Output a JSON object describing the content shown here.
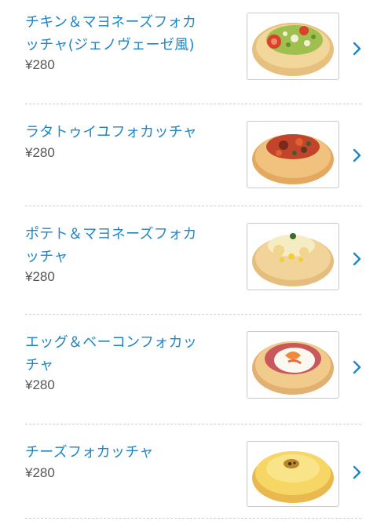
{
  "items": [
    {
      "name_line1": "チキン＆マヨネーズフォカ",
      "name_line2": "ッチャ(ジェノヴェーゼ風)",
      "price": "¥280",
      "image_icon": "chicken-mayo-focaccia-photo",
      "chevron_icon": "chevron-right-icon"
    },
    {
      "name_line1": "ラタトゥイユフォカッチャ",
      "name_line2": "",
      "price": "¥280",
      "image_icon": "ratatouille-focaccia-photo",
      "chevron_icon": "chevron-right-icon"
    },
    {
      "name_line1": "ポテト＆マヨネーズフォカ",
      "name_line2": "ッチャ",
      "price": "¥280",
      "image_icon": "potato-mayo-focaccia-photo",
      "chevron_icon": "chevron-right-icon"
    },
    {
      "name_line1": "エッグ＆ベーコンフォカッ",
      "name_line2": "チャ",
      "price": "¥280",
      "image_icon": "egg-bacon-focaccia-photo",
      "chevron_icon": "chevron-right-icon"
    },
    {
      "name_line1": "チーズフォカッチャ",
      "name_line2": "",
      "price": "¥280",
      "image_icon": "cheese-focaccia-photo",
      "chevron_icon": "chevron-right-icon"
    }
  ],
  "colors": {
    "link": "#1f86c6",
    "price": "#555555",
    "divider": "#cfcfcf"
  }
}
